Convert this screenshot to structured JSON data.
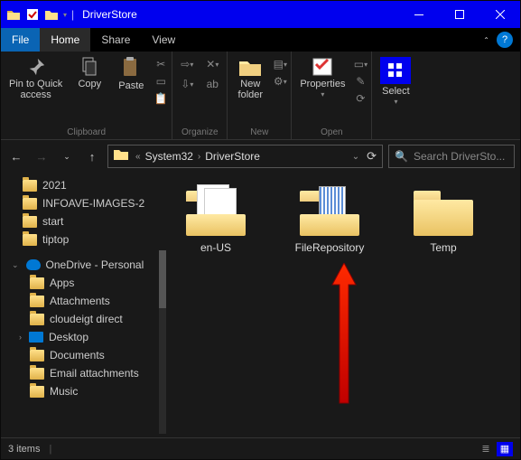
{
  "titlebar": {
    "title": "DriverStore"
  },
  "menu": {
    "file": "File",
    "home": "Home",
    "share": "Share",
    "view": "View"
  },
  "ribbon": {
    "clipboard": {
      "label": "Clipboard",
      "pin": "Pin to Quick\naccess",
      "copy": "Copy",
      "paste": "Paste"
    },
    "organize": {
      "label": "Organize"
    },
    "new": {
      "label": "New",
      "new_folder": "New\nfolder"
    },
    "open": {
      "label": "Open",
      "properties": "Properties"
    },
    "select": "Select"
  },
  "address": {
    "seg1": "System32",
    "seg2": "DriverStore"
  },
  "search": {
    "placeholder": "Search DriverSto..."
  },
  "tree": {
    "items_top": [
      "2021",
      "INFOAVE-IMAGES-2",
      "start",
      "tiptop"
    ],
    "onedrive": "OneDrive - Personal",
    "children": [
      "Apps",
      "Attachments",
      "cloudeigt direct",
      "Desktop",
      "Documents",
      "Email attachments",
      "Music"
    ]
  },
  "folders": [
    {
      "label": "en-US",
      "type": "pages"
    },
    {
      "label": "FileRepository",
      "type": "repo"
    },
    {
      "label": "Temp",
      "type": "plain"
    }
  ],
  "status": {
    "count": "3 items"
  }
}
